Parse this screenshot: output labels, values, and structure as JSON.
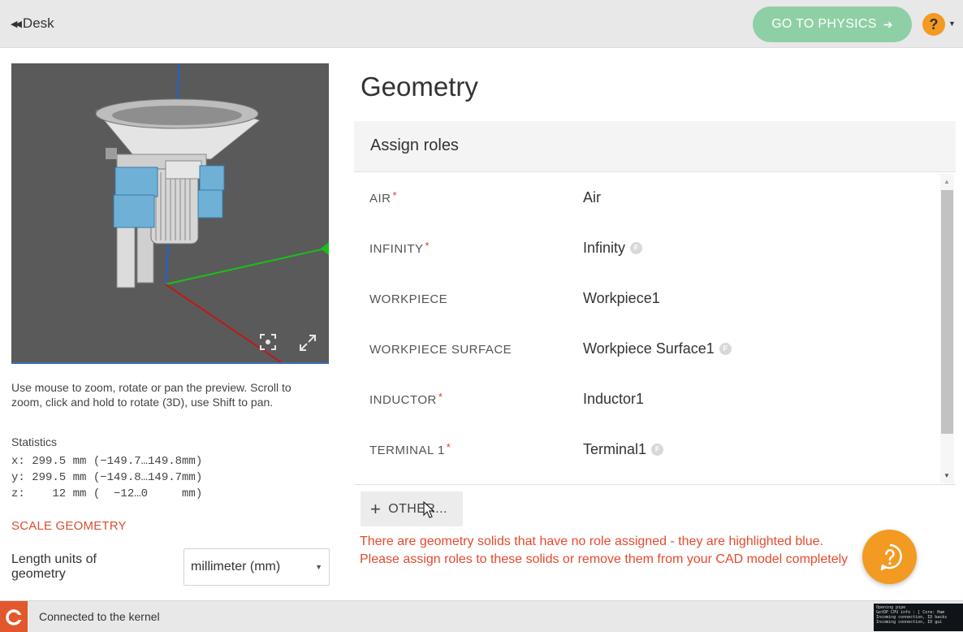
{
  "topbar": {
    "back_label": "Desk",
    "go_physics_label": "GO TO PHYSICS",
    "help_symbol": "?"
  },
  "viewport": {
    "hint": "Use mouse to zoom, rotate or pan the preview. Scroll to zoom, click and hold to rotate (3D), use Shift to pan.",
    "icons": [
      "focus-icon",
      "expand-icon"
    ]
  },
  "statistics": {
    "title": "Statistics",
    "rows": [
      "x: 299.5 mm (−149.7…149.8mm)",
      "y: 299.5 mm (−149.8…149.7mm)",
      "z:    12 mm (  −12…0     mm)"
    ]
  },
  "scale_geometry_label": "SCALE GEOMETRY",
  "units": {
    "label": "Length units of geometry",
    "selected": "millimeter (mm)"
  },
  "page_title": "Geometry",
  "assign_roles": {
    "header": "Assign roles",
    "rows": [
      {
        "role": "AIR",
        "required": "*",
        "value": "Air",
        "badge": ""
      },
      {
        "role": "INFINITY",
        "required": "*",
        "value": "Infinity",
        "badge": "F"
      },
      {
        "role": "WORKPIECE",
        "required": "",
        "value": "Workpiece1",
        "badge": ""
      },
      {
        "role": "WORKPIECE SURFACE",
        "required": "",
        "value": "Workpiece Surface1",
        "badge": "F"
      },
      {
        "role": "INDUCTOR",
        "required": "*",
        "value": "Inductor1",
        "badge": ""
      },
      {
        "role": "TERMINAL 1",
        "required": "*",
        "value": "Terminal1",
        "badge": "F"
      }
    ]
  },
  "other_button_label": "OTHER...",
  "warning": "There are geometry solids that have no role assigned - they are highlighted blue. Please assign roles to these solids or remove them from your CAD model completely",
  "status": {
    "connection": "Connected to the kernel",
    "console_lines": [
      "Opening pipe",
      "GetDP CPU info : [ Core: Ham",
      "Incoming connection, ID backs",
      "Incoming connection, ID gui"
    ]
  },
  "colors": {
    "accent_green": "#8fcfa5",
    "help_orange": "#f29a21",
    "warning_red": "#e64a2e",
    "link_red": "#d64e33",
    "model_blue": "#6fb1d6"
  }
}
